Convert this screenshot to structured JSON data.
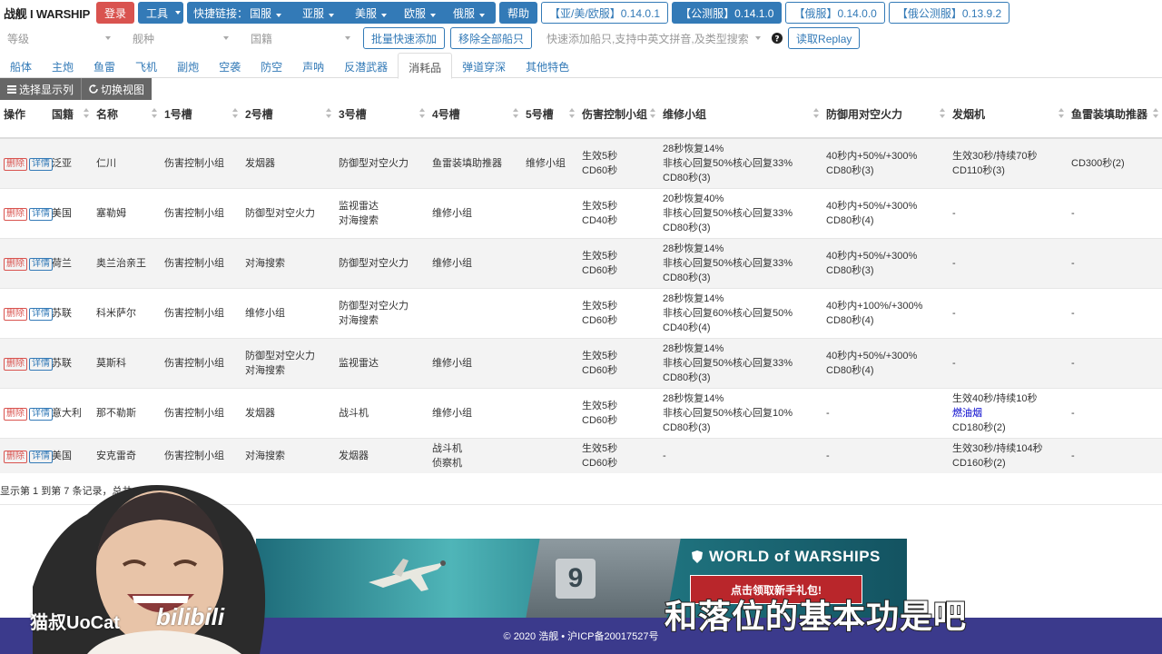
{
  "nav": {
    "logo": "战舰 I WARSHIP",
    "login": "登录",
    "tools": "工具",
    "quicklinks_label": "快捷链接：",
    "region_buttons": [
      "国服",
      "亚服",
      "美服",
      "欧服",
      "俄服"
    ],
    "help": "帮助",
    "versions": [
      "【亚/美/欧服】0.14.0.1",
      "【公测服】0.14.1.0",
      "【俄服】0.14.0.0",
      "【俄公测服】0.13.9.2"
    ]
  },
  "filters": {
    "tier": "等级",
    "class": "舰种",
    "nation": "国籍",
    "bulk_add": "批量快速添加",
    "remove_all": "移除全部船只",
    "search_placeholder": "快速添加船只,支持中英文拼音,及类型搜索",
    "read_replay": "读取Replay"
  },
  "tabs": [
    "船体",
    "主炮",
    "鱼雷",
    "飞机",
    "副炮",
    "空袭",
    "防空",
    "声呐",
    "反潜武器",
    "消耗品",
    "弹道穿深",
    "其他特色"
  ],
  "active_tab": 9,
  "toolbar": {
    "select_columns": "选择显示列",
    "switch_view": "切换视图"
  },
  "table": {
    "headers": [
      "操作",
      "国籍",
      "名称",
      "1号槽",
      "2号槽",
      "3号槽",
      "4号槽",
      "5号槽",
      "伤害控制小组",
      "维修小组",
      "防御用对空火力",
      "发烟机",
      "鱼雷装填助推器"
    ],
    "delete_label": "删除",
    "detail_label": "详情",
    "rows": [
      {
        "nation": "泛亚",
        "name": "仁川",
        "s1": [
          "伤害控制小组"
        ],
        "s2": [
          "发烟器"
        ],
        "s3": [
          "防御型对空火力"
        ],
        "s4": [
          "鱼雷装填助推器"
        ],
        "s5": [
          "维修小组"
        ],
        "dc": [
          "生效5秒",
          "CD60秒"
        ],
        "rep": [
          "28秒恢复14%",
          "非核心回复50%核心回复33%",
          "CD80秒(3)"
        ],
        "aa": [
          "40秒内+50%/+300%",
          "CD80秒(3)"
        ],
        "smoke": [
          "生效30秒/持续70秒",
          "CD110秒(3)"
        ],
        "torp": [
          "CD300秒(2)"
        ]
      },
      {
        "nation": "美国",
        "name": "塞勒姆",
        "s1": [
          "伤害控制小组"
        ],
        "s2": [
          "防御型对空火力"
        ],
        "s3": [
          "监视雷达",
          "对海搜索"
        ],
        "s4": [
          "维修小组"
        ],
        "s5": [],
        "dc": [
          "生效5秒",
          "CD40秒"
        ],
        "rep": [
          "20秒恢复40%",
          "非核心回复50%核心回复33%",
          "CD80秒(3)"
        ],
        "aa": [
          "40秒内+50%/+300%",
          "CD80秒(4)"
        ],
        "smoke": [
          "-"
        ],
        "torp": [
          "-"
        ]
      },
      {
        "nation": "荷兰",
        "name": "奥兰治亲王",
        "s1": [
          "伤害控制小组"
        ],
        "s2": [
          "对海搜索"
        ],
        "s3": [
          "防御型对空火力"
        ],
        "s4": [
          "维修小组"
        ],
        "s5": [],
        "dc": [
          "生效5秒",
          "CD60秒"
        ],
        "rep": [
          "28秒恢复14%",
          "非核心回复50%核心回复33%",
          "CD80秒(3)"
        ],
        "aa": [
          "40秒内+50%/+300%",
          "CD80秒(3)"
        ],
        "smoke": [
          "-"
        ],
        "torp": [
          "-"
        ]
      },
      {
        "nation": "苏联",
        "name": "科米萨尔",
        "s1": [
          "伤害控制小组"
        ],
        "s2": [
          "维修小组"
        ],
        "s3": [
          "防御型对空火力",
          "对海搜索"
        ],
        "s4": [],
        "s5": [],
        "dc": [
          "生效5秒",
          "CD60秒"
        ],
        "rep": [
          "28秒恢复14%",
          "非核心回复60%核心回复50%",
          "CD40秒(4)"
        ],
        "aa": [
          "40秒内+100%/+300%",
          "CD80秒(4)"
        ],
        "smoke": [
          "-"
        ],
        "torp": [
          "-"
        ]
      },
      {
        "nation": "苏联",
        "name": "莫斯科",
        "s1": [
          "伤害控制小组"
        ],
        "s2": [
          "防御型对空火力",
          "对海搜索"
        ],
        "s3": [
          "监视雷达"
        ],
        "s4": [
          "维修小组"
        ],
        "s5": [],
        "dc": [
          "生效5秒",
          "CD60秒"
        ],
        "rep": [
          "28秒恢复14%",
          "非核心回复50%核心回复33%",
          "CD80秒(3)"
        ],
        "aa": [
          "40秒内+50%/+300%",
          "CD80秒(4)"
        ],
        "smoke": [
          "-"
        ],
        "torp": [
          "-"
        ]
      },
      {
        "nation": "意大利",
        "name": "那不勒斯",
        "s1": [
          "伤害控制小组"
        ],
        "s2": [
          "发烟器"
        ],
        "s3": [
          "战斗机"
        ],
        "s4": [
          "维修小组"
        ],
        "s5": [],
        "dc": [
          "生效5秒",
          "CD60秒"
        ],
        "rep": [
          "28秒恢复14%",
          "非核心回复50%核心回复10%",
          "CD80秒(3)"
        ],
        "aa": [
          "-"
        ],
        "smoke": [
          "生效40秒/持续10秒",
          "燃油烟",
          "CD180秒(2)"
        ],
        "torp": [
          "-"
        ]
      },
      {
        "nation": "美国",
        "name": "安克雷奇",
        "s1": [
          "伤害控制小组"
        ],
        "s2": [
          "对海搜索"
        ],
        "s3": [
          "发烟器"
        ],
        "s4": [
          "战斗机",
          "侦察机"
        ],
        "s5": [],
        "dc": [
          "生效5秒",
          "CD60秒"
        ],
        "rep": [
          "-"
        ],
        "aa": [
          "-"
        ],
        "smoke": [
          "生效30秒/持续104秒",
          "CD160秒(2)"
        ],
        "torp": [
          "-"
        ]
      }
    ]
  },
  "pager": "显示第 1 到第 7 条记录，总共 7 条记录",
  "footer": "© 2020 浩舰 • 沪ICP备20017527号",
  "ad": {
    "brand": "WORLD of WARSHIPS",
    "cta": "点击领取新手礼包!",
    "ship_number": "9"
  },
  "overlay": {
    "subtitle": "和落位的基本功是吧",
    "watermark": "猫叔UoCat",
    "watermark2": "bilibili"
  },
  "colors": {
    "primary": "#337ab7",
    "danger": "#d9534f",
    "footer": "#3b3a8c"
  }
}
